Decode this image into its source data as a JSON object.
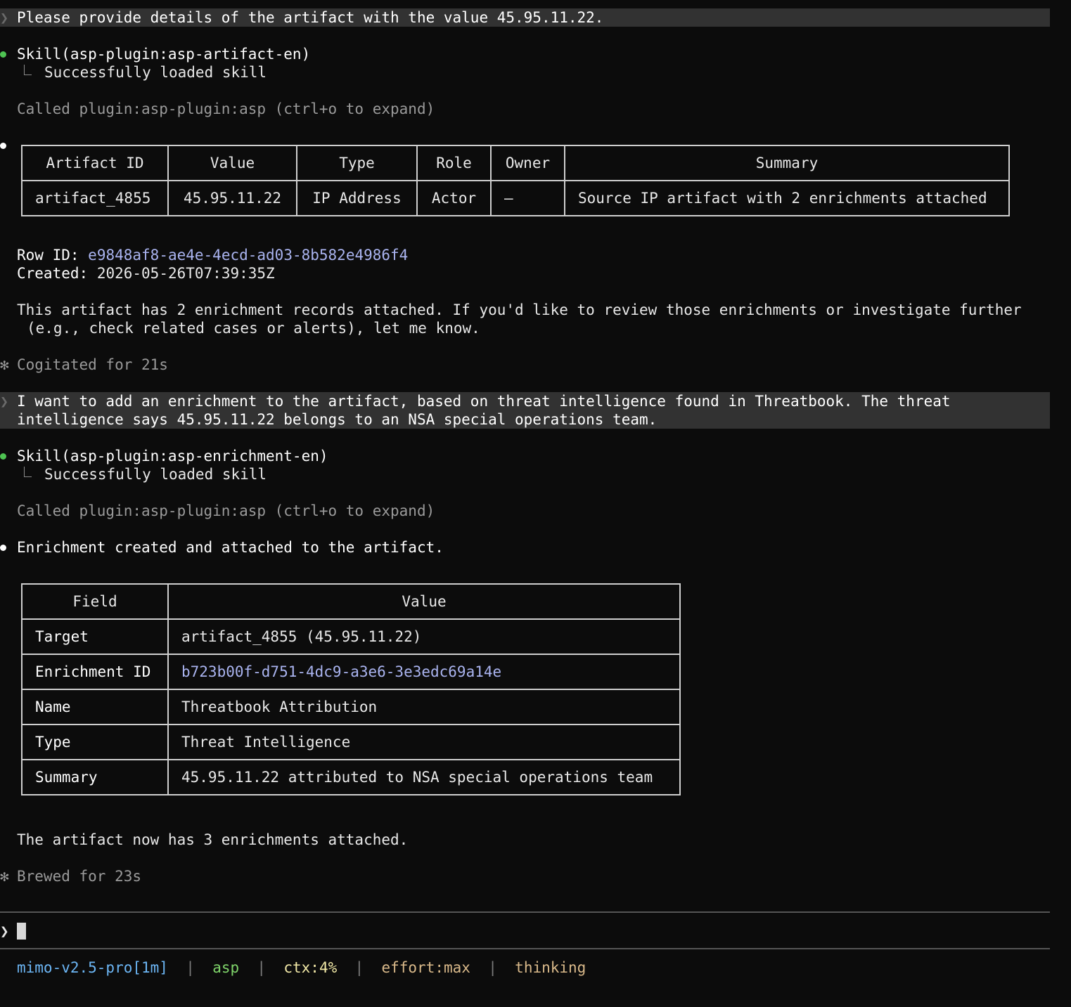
{
  "conversation": {
    "prompt1": "Please provide details of the artifact with the value 45.95.11.22.",
    "skill1": "Skill(asp-plugin:asp-artifact-en)",
    "skill1_result": "Successfully loaded skill",
    "called1": "Called plugin:asp-plugin:asp (ctrl+o to expand)",
    "artifact_table": {
      "headers": [
        "Artifact ID",
        "Value",
        "Type",
        "Role",
        "Owner",
        "Summary"
      ],
      "row": [
        "artifact_4855",
        "45.95.11.22",
        "IP Address",
        "Actor",
        "—",
        "Source IP artifact with 2 enrichments attached"
      ]
    },
    "row_id_label": "Row ID:",
    "row_id_value": "e9848af8-ae4e-4ecd-ad03-8b582e4986f4",
    "created_label": "Created:",
    "created_value": "2026-05-26T07:39:35Z",
    "info_line1": "This artifact has 2 enrichment records attached. If you'd like to review those enrichments or investigate further",
    "info_line2": "(e.g., check related cases or alerts), let me know.",
    "cogitated": "Cogitated for 21s",
    "prompt2_line1": "I want to add an enrichment to the artifact, based on threat intelligence found in Threatbook. The threat",
    "prompt2_line2": "intelligence says 45.95.11.22 belongs to an NSA special operations team.",
    "skill2": "Skill(asp-plugin:asp-enrichment-en)",
    "skill2_result": "Successfully loaded skill",
    "called2": "Called plugin:asp-plugin:asp (ctrl+o to expand)",
    "enrichment_created": "Enrichment created and attached to the artifact.",
    "enrichment_table": {
      "headers": [
        "Field",
        "Value"
      ],
      "rows": [
        {
          "field": "Target",
          "value": "artifact_4855 (45.95.11.22)"
        },
        {
          "field": "Enrichment ID",
          "value": "b723b00f-d751-4dc9-a3e6-3e3edc69a14e"
        },
        {
          "field": "Name",
          "value": "Threatbook Attribution"
        },
        {
          "field": "Type",
          "value": "Threat Intelligence"
        },
        {
          "field": "Summary",
          "value": "45.95.11.22 attributed to NSA special operations team"
        }
      ]
    },
    "final_note": "The artifact now has 3 enrichments attached.",
    "brewed": "Brewed for 23s"
  },
  "input": {
    "chevron": "❯",
    "value": ""
  },
  "status_bar": {
    "model": "mimo-v2.5-pro[1m]",
    "project": "asp",
    "ctx": "ctx:4%",
    "effort": "effort:max",
    "mode": "thinking",
    "separator": "|"
  },
  "icons": {
    "prompt_chevron": "❯",
    "spinner_glyph": "✻"
  },
  "colors": {
    "background": "#0c0c0c",
    "prompt_band": "#323232",
    "success_dot": "#4ec352",
    "uuid": "#aab4f0",
    "model": "#6cb6f5",
    "project": "#7fd46a",
    "ctx": "#f2e9a7",
    "effort": "#d9b98a"
  }
}
